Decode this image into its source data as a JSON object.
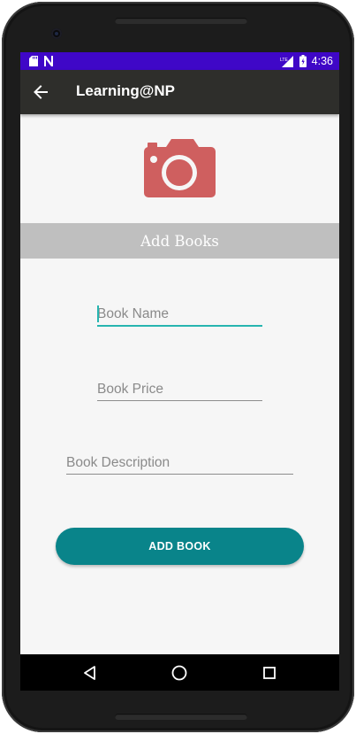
{
  "status_bar": {
    "time": "4:36",
    "network": "LTE",
    "icons": [
      "sd-card-icon",
      "n-notification-icon",
      "signal-icon",
      "battery-icon"
    ]
  },
  "app_bar": {
    "title": "Learning@NP",
    "back_icon": "arrow-back-icon"
  },
  "image_picker": {
    "icon": "camera-icon",
    "color": "#cf5f5f"
  },
  "banner": {
    "title": "Add Books"
  },
  "form": {
    "book_name_placeholder": "Book Name",
    "book_price_placeholder": "Book Price",
    "book_description_placeholder": "Book Description",
    "book_name_value": "",
    "book_price_value": "",
    "book_description_value": ""
  },
  "actions": {
    "add_book_label": "ADD BOOK"
  },
  "nav_bar": {
    "icons": [
      "back-triangle-icon",
      "home-circle-icon",
      "recents-square-icon"
    ]
  },
  "colors": {
    "status_bar": "#3f07c7",
    "app_bar": "#2e2e2b",
    "accent": "#27b5b0",
    "button": "#09848a",
    "banner": "#bfbfbf"
  }
}
